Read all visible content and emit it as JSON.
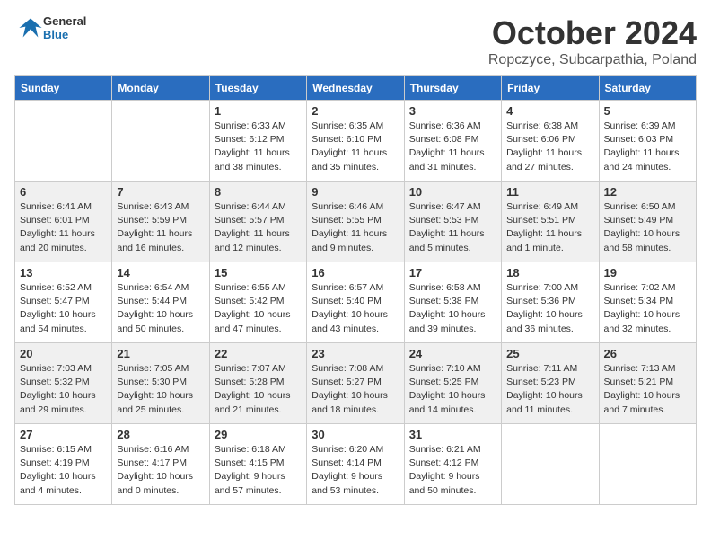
{
  "header": {
    "logo_general": "General",
    "logo_blue": "Blue",
    "month": "October 2024",
    "location": "Ropczyce, Subcarpathia, Poland"
  },
  "days_of_week": [
    "Sunday",
    "Monday",
    "Tuesday",
    "Wednesday",
    "Thursday",
    "Friday",
    "Saturday"
  ],
  "weeks": [
    [
      {
        "day": "",
        "info": ""
      },
      {
        "day": "",
        "info": ""
      },
      {
        "day": "1",
        "info": "Sunrise: 6:33 AM\nSunset: 6:12 PM\nDaylight: 11 hours and 38 minutes."
      },
      {
        "day": "2",
        "info": "Sunrise: 6:35 AM\nSunset: 6:10 PM\nDaylight: 11 hours and 35 minutes."
      },
      {
        "day": "3",
        "info": "Sunrise: 6:36 AM\nSunset: 6:08 PM\nDaylight: 11 hours and 31 minutes."
      },
      {
        "day": "4",
        "info": "Sunrise: 6:38 AM\nSunset: 6:06 PM\nDaylight: 11 hours and 27 minutes."
      },
      {
        "day": "5",
        "info": "Sunrise: 6:39 AM\nSunset: 6:03 PM\nDaylight: 11 hours and 24 minutes."
      }
    ],
    [
      {
        "day": "6",
        "info": "Sunrise: 6:41 AM\nSunset: 6:01 PM\nDaylight: 11 hours and 20 minutes."
      },
      {
        "day": "7",
        "info": "Sunrise: 6:43 AM\nSunset: 5:59 PM\nDaylight: 11 hours and 16 minutes."
      },
      {
        "day": "8",
        "info": "Sunrise: 6:44 AM\nSunset: 5:57 PM\nDaylight: 11 hours and 12 minutes."
      },
      {
        "day": "9",
        "info": "Sunrise: 6:46 AM\nSunset: 5:55 PM\nDaylight: 11 hours and 9 minutes."
      },
      {
        "day": "10",
        "info": "Sunrise: 6:47 AM\nSunset: 5:53 PM\nDaylight: 11 hours and 5 minutes."
      },
      {
        "day": "11",
        "info": "Sunrise: 6:49 AM\nSunset: 5:51 PM\nDaylight: 11 hours and 1 minute."
      },
      {
        "day": "12",
        "info": "Sunrise: 6:50 AM\nSunset: 5:49 PM\nDaylight: 10 hours and 58 minutes."
      }
    ],
    [
      {
        "day": "13",
        "info": "Sunrise: 6:52 AM\nSunset: 5:47 PM\nDaylight: 10 hours and 54 minutes."
      },
      {
        "day": "14",
        "info": "Sunrise: 6:54 AM\nSunset: 5:44 PM\nDaylight: 10 hours and 50 minutes."
      },
      {
        "day": "15",
        "info": "Sunrise: 6:55 AM\nSunset: 5:42 PM\nDaylight: 10 hours and 47 minutes."
      },
      {
        "day": "16",
        "info": "Sunrise: 6:57 AM\nSunset: 5:40 PM\nDaylight: 10 hours and 43 minutes."
      },
      {
        "day": "17",
        "info": "Sunrise: 6:58 AM\nSunset: 5:38 PM\nDaylight: 10 hours and 39 minutes."
      },
      {
        "day": "18",
        "info": "Sunrise: 7:00 AM\nSunset: 5:36 PM\nDaylight: 10 hours and 36 minutes."
      },
      {
        "day": "19",
        "info": "Sunrise: 7:02 AM\nSunset: 5:34 PM\nDaylight: 10 hours and 32 minutes."
      }
    ],
    [
      {
        "day": "20",
        "info": "Sunrise: 7:03 AM\nSunset: 5:32 PM\nDaylight: 10 hours and 29 minutes."
      },
      {
        "day": "21",
        "info": "Sunrise: 7:05 AM\nSunset: 5:30 PM\nDaylight: 10 hours and 25 minutes."
      },
      {
        "day": "22",
        "info": "Sunrise: 7:07 AM\nSunset: 5:28 PM\nDaylight: 10 hours and 21 minutes."
      },
      {
        "day": "23",
        "info": "Sunrise: 7:08 AM\nSunset: 5:27 PM\nDaylight: 10 hours and 18 minutes."
      },
      {
        "day": "24",
        "info": "Sunrise: 7:10 AM\nSunset: 5:25 PM\nDaylight: 10 hours and 14 minutes."
      },
      {
        "day": "25",
        "info": "Sunrise: 7:11 AM\nSunset: 5:23 PM\nDaylight: 10 hours and 11 minutes."
      },
      {
        "day": "26",
        "info": "Sunrise: 7:13 AM\nSunset: 5:21 PM\nDaylight: 10 hours and 7 minutes."
      }
    ],
    [
      {
        "day": "27",
        "info": "Sunrise: 6:15 AM\nSunset: 4:19 PM\nDaylight: 10 hours and 4 minutes."
      },
      {
        "day": "28",
        "info": "Sunrise: 6:16 AM\nSunset: 4:17 PM\nDaylight: 10 hours and 0 minutes."
      },
      {
        "day": "29",
        "info": "Sunrise: 6:18 AM\nSunset: 4:15 PM\nDaylight: 9 hours and 57 minutes."
      },
      {
        "day": "30",
        "info": "Sunrise: 6:20 AM\nSunset: 4:14 PM\nDaylight: 9 hours and 53 minutes."
      },
      {
        "day": "31",
        "info": "Sunrise: 6:21 AM\nSunset: 4:12 PM\nDaylight: 9 hours and 50 minutes."
      },
      {
        "day": "",
        "info": ""
      },
      {
        "day": "",
        "info": ""
      }
    ]
  ]
}
